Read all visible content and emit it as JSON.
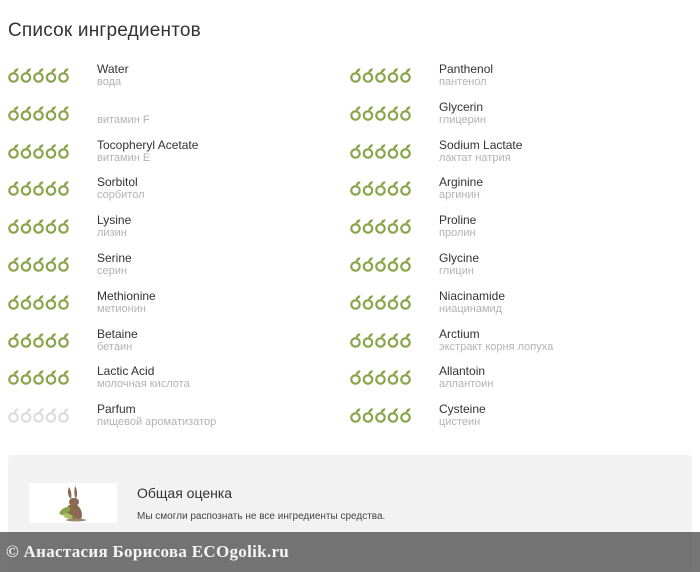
{
  "section_title": "Список ингредиентов",
  "colors": {
    "leaf_green": "#8aa44a",
    "leaf_empty": "#dcdcdc",
    "secondary_text": "#b3b3b3"
  },
  "ingredients_left": [
    {
      "name": "Water",
      "translation": "вода",
      "rating": 5
    },
    {
      "name": "",
      "translation": "витамин F",
      "rating": 5
    },
    {
      "name": "Tocopheryl Acetate",
      "translation": "витамин E",
      "rating": 5
    },
    {
      "name": "Sorbitol",
      "translation": "сорбитол",
      "rating": 5
    },
    {
      "name": "Lysine",
      "translation": "лизин",
      "rating": 5
    },
    {
      "name": "Serine",
      "translation": "серин",
      "rating": 5
    },
    {
      "name": "Methionine",
      "translation": "метионин",
      "rating": 5
    },
    {
      "name": "Betaine",
      "translation": "бетаин",
      "rating": 5
    },
    {
      "name": "Lactic Acid",
      "translation": "молочная кислота",
      "rating": 5
    },
    {
      "name": "Parfum",
      "translation": "пищевой ароматизатор",
      "rating": 0
    }
  ],
  "ingredients_right": [
    {
      "name": "Panthenol",
      "translation": "пантенол",
      "rating": 5
    },
    {
      "name": "Glycerin",
      "translation": "глицерин",
      "rating": 5
    },
    {
      "name": "Sodium Lactate",
      "translation": "лактат натрия",
      "rating": 5
    },
    {
      "name": "Arginine",
      "translation": "аргинин",
      "rating": 5
    },
    {
      "name": "Proline",
      "translation": "пролин",
      "rating": 5
    },
    {
      "name": "Glycine",
      "translation": "глицин",
      "rating": 5
    },
    {
      "name": "Niacinamide",
      "translation": "ниацинамид",
      "rating": 5
    },
    {
      "name": "Arctium",
      "translation": "экстракт корня лопуха",
      "rating": 5
    },
    {
      "name": "Allantoin",
      "translation": "аллантоин",
      "rating": 5
    },
    {
      "name": "Cysteine",
      "translation": "цистеин",
      "rating": 5
    }
  ],
  "summary": {
    "title": "Общая оценка",
    "text": "Мы смогли распознать не все ингредиенты средства.",
    "logo_icon": "rabbit-logo-icon"
  },
  "watermark": "© Анастасия Борисова ECOgolik.ru"
}
